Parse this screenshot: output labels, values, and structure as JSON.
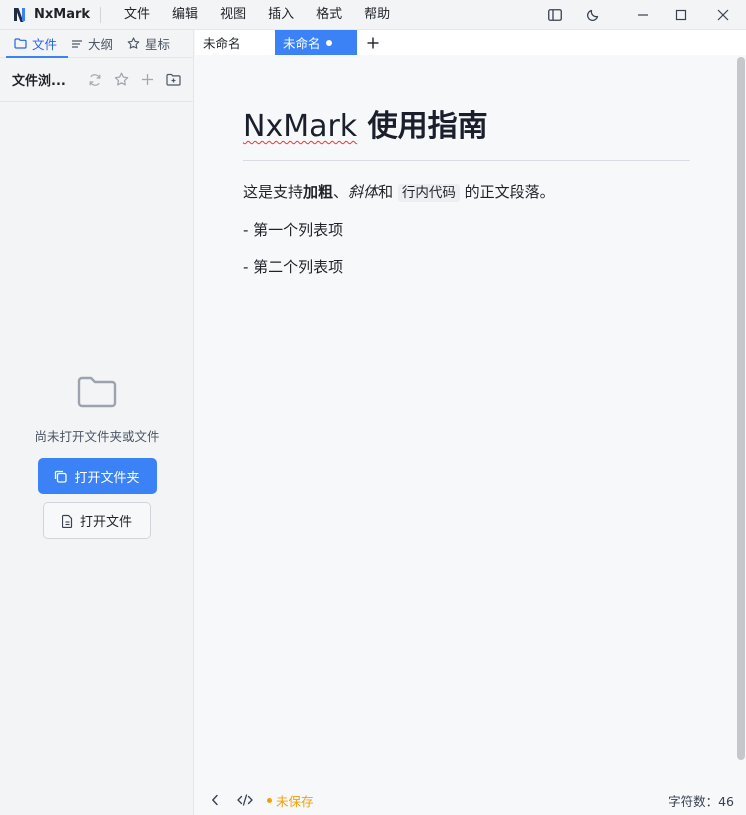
{
  "app": {
    "name": "NxMark",
    "menu": [
      "文件",
      "编辑",
      "视图",
      "插入",
      "格式",
      "帮助"
    ]
  },
  "sidebar": {
    "tabs": [
      {
        "label": "文件",
        "icon": "folder-icon",
        "active": true
      },
      {
        "label": "大纲",
        "icon": "outline-icon",
        "active": false
      },
      {
        "label": "星标",
        "icon": "star-icon",
        "active": false
      }
    ],
    "explorer_title": "文件浏...",
    "empty_text": "尚未打开文件夹或文件",
    "open_folder_label": "打开文件夹",
    "open_file_label": "打开文件"
  },
  "editor_tabs": [
    {
      "label": "未命名",
      "active": false,
      "modified": false
    },
    {
      "label": "未命名",
      "active": true,
      "modified": true
    }
  ],
  "document": {
    "title_brand": "NxMark",
    "title_rest": " 使用指南",
    "para_1": "这是支持",
    "para_bold": "加粗",
    "para_2": "、",
    "para_italic": "斜体",
    "para_3": "和 ",
    "para_code": "行内代码",
    "para_4": " 的正文段落。",
    "list_items": [
      "- 第一个列表项",
      "- 第二个列表项"
    ]
  },
  "status": {
    "save_state": "未保存",
    "char_count": "字符数：46"
  },
  "colors": {
    "accent": "#3b82f6",
    "unsaved": "#f59e0b"
  }
}
